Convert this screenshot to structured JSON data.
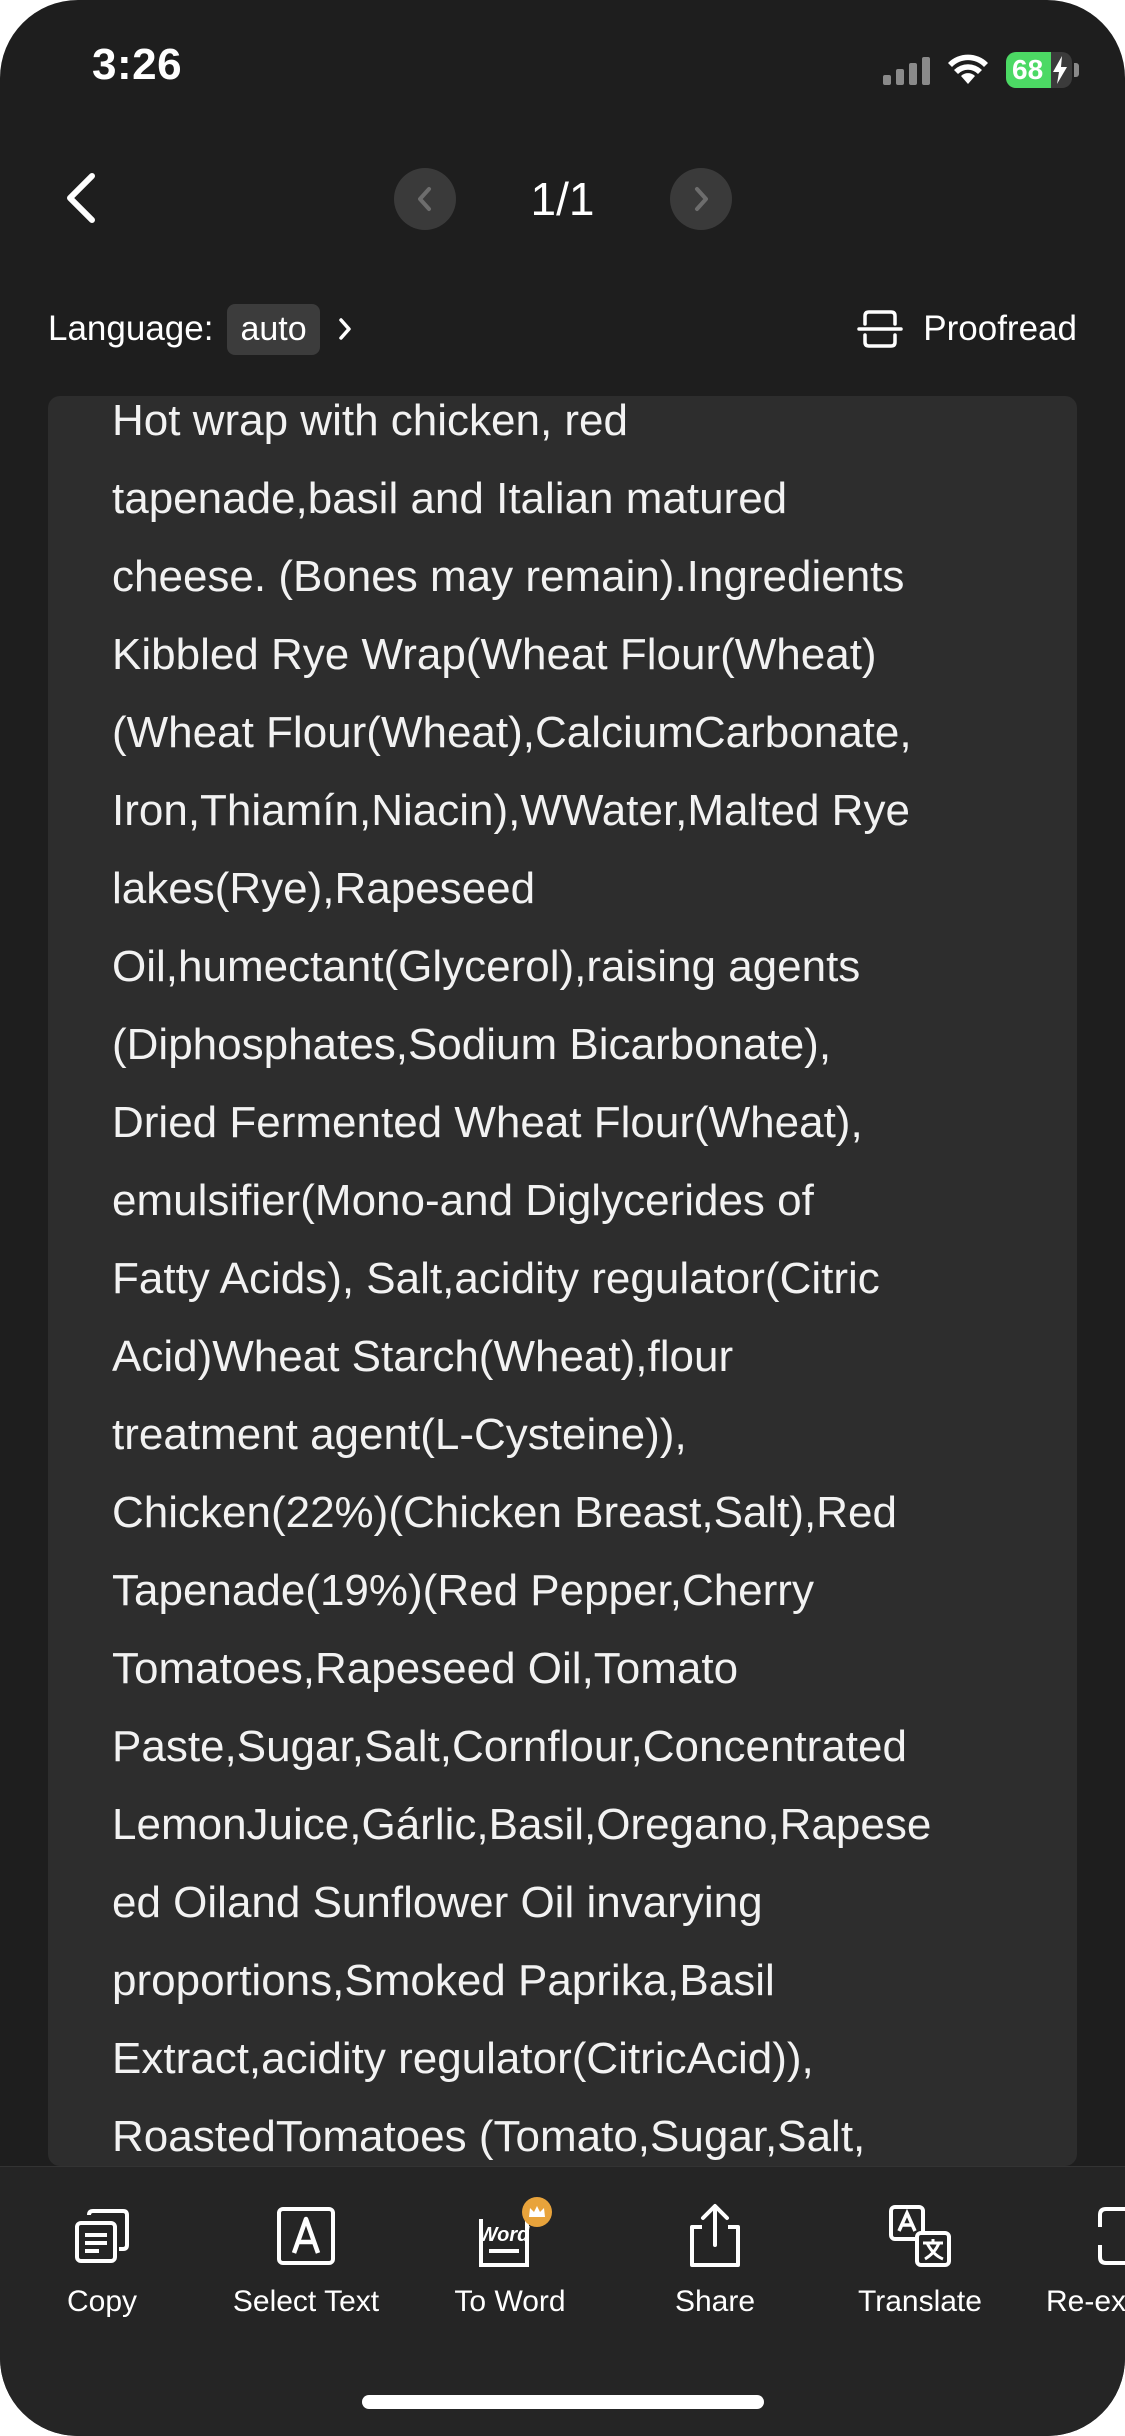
{
  "status_bar": {
    "time": "3:26",
    "battery_percent": "68",
    "battery_level": 0.68
  },
  "nav": {
    "page_indicator": "1/1"
  },
  "language": {
    "label": "Language:",
    "value": "auto"
  },
  "proofread": {
    "label": "Proofread"
  },
  "recognized_text": [
    "Hot wrap with chicken, red",
    "tapenade,basil and Italian matured",
    "cheese. (Bones may remain).Ingredients",
    "Kibbled Rye Wrap(Wheat Flour(Wheat)",
    "(Wheat Flour(Wheat),CalciumCarbonate,",
    "Iron,Thiamín,Niacin),WWater,Malted Rye",
    "lakes(Rye),Rapeseed",
    "Oil,humectant(Glycerol),raising agents",
    "(Diphosphates,Sodium Bicarbonate),",
    "Dried Fermented Wheat Flour(Wheat),",
    "emulsifier(Mono-and Diglycerides of",
    "Fatty Acids), Salt,acidity regulator(Citric",
    "Acid)Wheat Starch(Wheat),flour",
    "treatment agent(L-Cysteine)),",
    "Chicken(22%)(Chicken Breast,Salt),Red",
    "Tapenade(19%)(Red Pepper,Cherry",
    "Tomatoes,Rapeseed Oil,Tomato",
    "Paste,Sugar,Salt,Cornflour,Concentrated",
    "LemonJuice,Gárlic,Basil,Oregano,Rapese",
    "ed Oiland Sunflower Oil invarying",
    "proportions,Smoked Paprika,Basil",
    "Extract,acidity regulator(CitricAcid)),",
    "RoastedTomatoes (Tomato,Sugar,Salt,"
  ],
  "toolbar": {
    "copy": "Copy",
    "select_text": "Select Text",
    "to_word": "To Word",
    "to_word_badge": "Word",
    "share": "Share",
    "translate": "Translate",
    "re_extract": "Re-ex"
  },
  "colors": {
    "background": "#1e1e1e",
    "panel": "#2d2d2d",
    "battery": "#4cd964",
    "premium": "#e8a33b"
  }
}
